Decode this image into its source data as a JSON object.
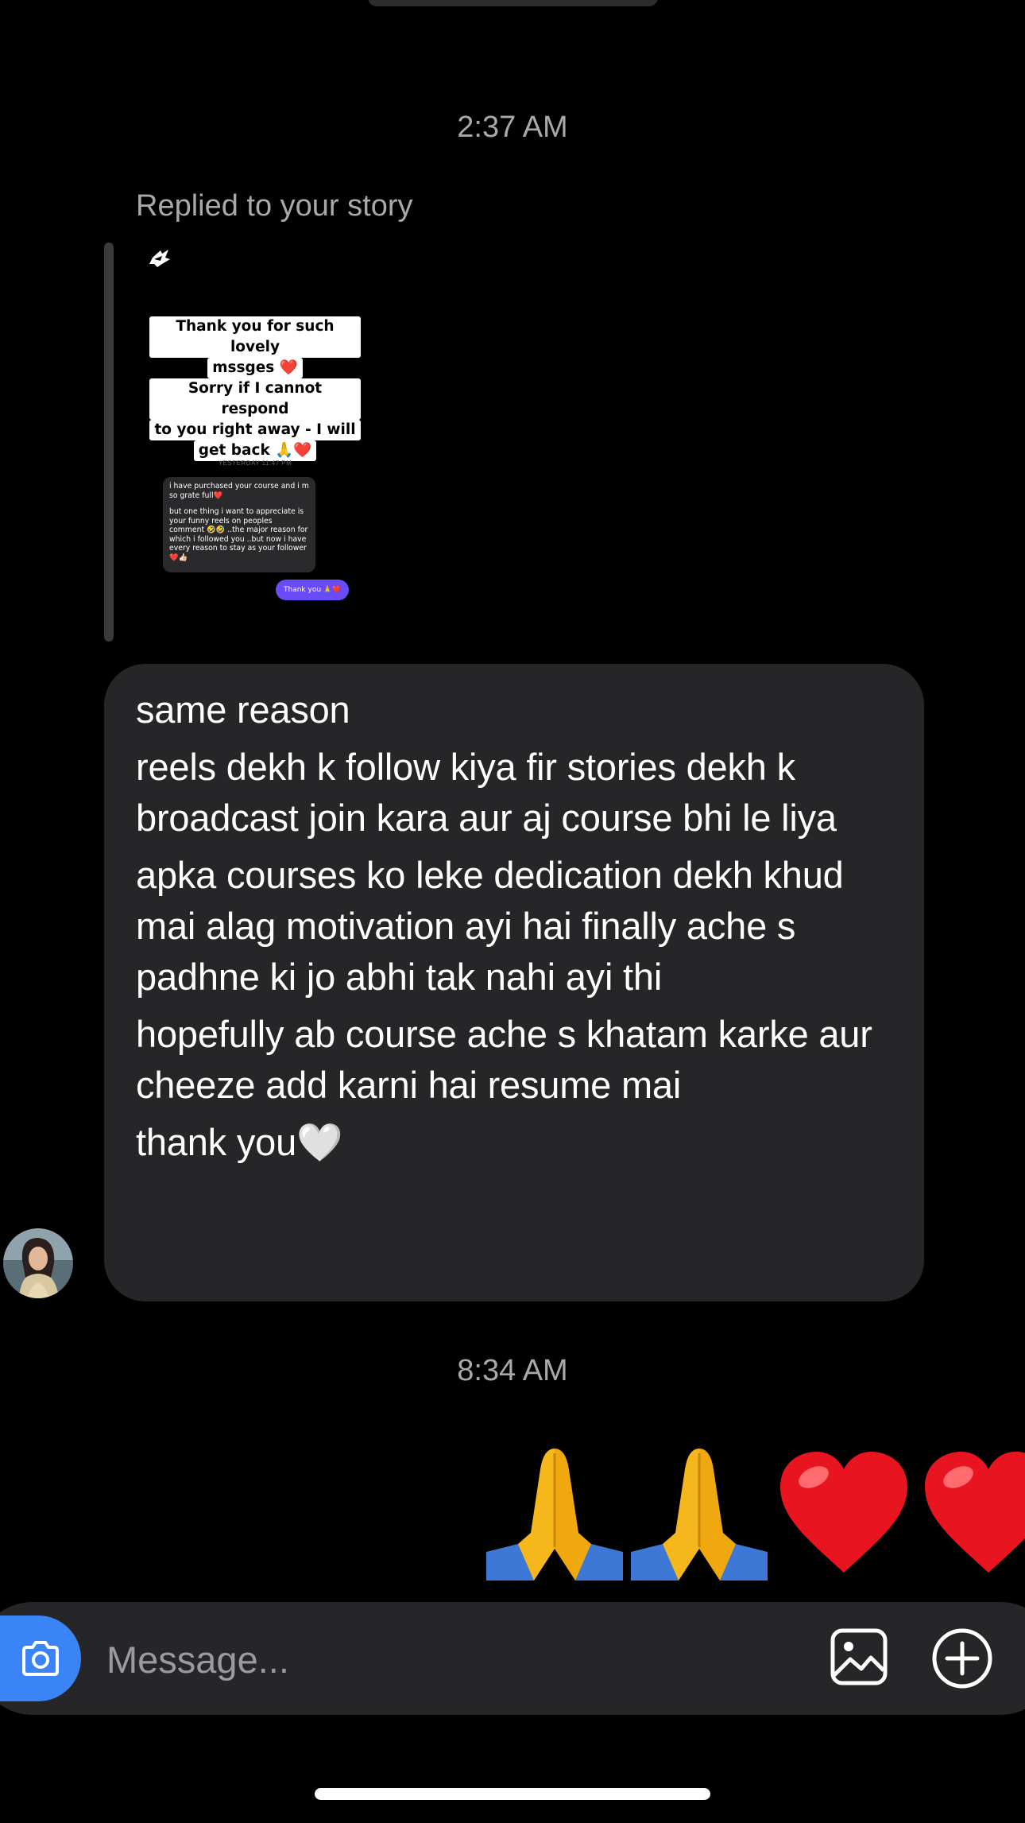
{
  "thread": {
    "time_1": "2:37 AM",
    "reply_label": "Replied to your story",
    "story": {
      "card_lines": [
        "Thank you for such lovely",
        "mssges ❤️",
        "Sorry if I cannot respond",
        "to you right away - I will",
        "get back 🙏❤️"
      ],
      "dm_time": "YESTERDAY 11:47 PM",
      "dm_para_1": "i have purchased your course and i m so grate full❤️",
      "dm_para_2": "but one thing i want to appreciate is your funny reels on peoples comment 🤣🤣 ..the major reason for which i followed you ..but now i have every reason to stay as your follower❤️👍🏻",
      "thanks_reply": "Thank you 🙏❤️"
    },
    "message": {
      "paragraphs": [
        "same reason",
        "reels dekh k follow kiya fir stories dekh k broadcast join kara aur aj course bhi le liya",
        "apka courses ko leke dedication dekh khud mai alag motivation ayi hai finally ache s padhne ki jo abhi tak nahi ayi thi",
        "hopefully ab course ache s khatam karke aur cheeze add karni hai resume mai",
        "thank you🤍"
      ]
    },
    "time_2": "8:34 AM",
    "reaction_emojis": [
      "folded-hands",
      "folded-hands",
      "red-heart",
      "red-heart"
    ]
  },
  "composer": {
    "placeholder": "Message..."
  },
  "colors": {
    "background": "#000000",
    "bubble": "#262628",
    "accent": "#3a84f7",
    "muted_text": "#a8a8ad"
  }
}
